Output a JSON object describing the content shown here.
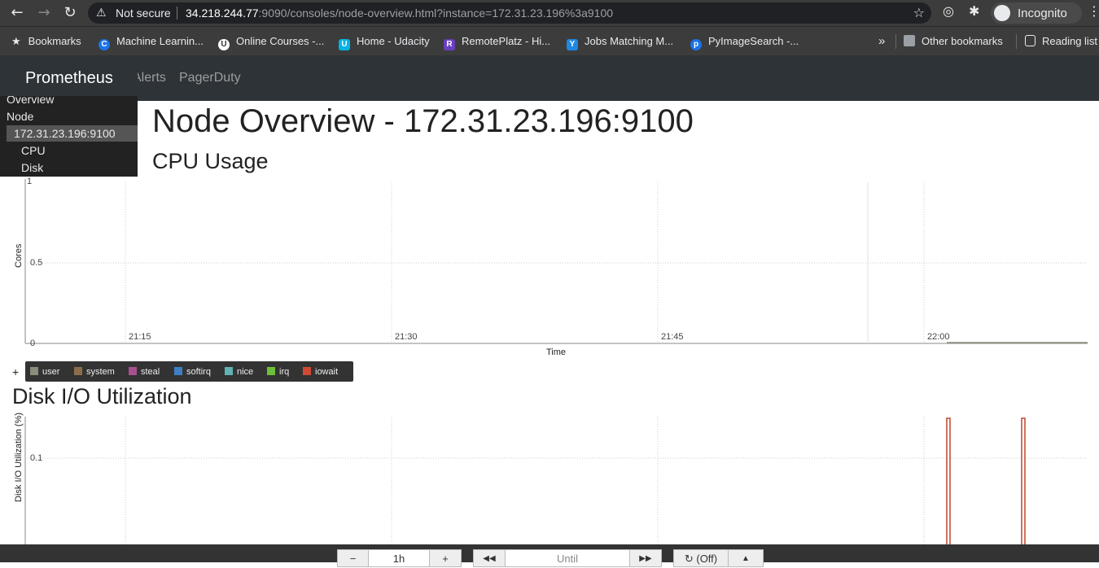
{
  "browser": {
    "security_label": "Not secure",
    "url_host": "34.218.244.77",
    "url_rest": ":9090/consoles/node-overview.html?instance=172.31.23.196%3a9100",
    "incognito_label": "Incognito",
    "bookmarks": [
      {
        "label": "Bookmarks",
        "icon": "star-icon"
      },
      {
        "label": "Machine Learnin...",
        "icon": "c-logo-icon",
        "color": "#1a73e8"
      },
      {
        "label": "Online Courses -...",
        "icon": "udemy-icon",
        "color": "#ffffff"
      },
      {
        "label": "Home - Udacity",
        "icon": "udacity-icon",
        "color": "#02b3e4"
      },
      {
        "label": "RemotePlatz - Hi...",
        "icon": "remoteplatz-icon",
        "color": "#6a3fbf"
      },
      {
        "label": "Jobs Matching M...",
        "icon": "jobs-icon",
        "color": "#1e88e5"
      },
      {
        "label": "PyImageSearch -...",
        "icon": "pyimagesearch-icon",
        "color": "#1a73e8"
      }
    ],
    "overflow_label": "»",
    "other_bookmarks": "Other bookmarks",
    "reading_list": "Reading list"
  },
  "nav": {
    "brand": "Prometheus",
    "links": [
      "Alerts",
      "PagerDuty"
    ]
  },
  "sidebar": {
    "items": [
      "Overview",
      "Node",
      "172.31.23.196:9100",
      "CPU",
      "Disk"
    ],
    "active_index": 2
  },
  "page": {
    "title": "Node Overview - 172.31.23.196:9100",
    "cpu_heading": "CPU Usage",
    "disk_heading": "Disk I/O Utilization"
  },
  "cpu_chart": {
    "ylabel": "Cores",
    "xlabel": "Time",
    "y_ticks": [
      "1",
      "0.5",
      "0"
    ],
    "x_ticks": [
      "21:15",
      "21:30",
      "21:45",
      "22:00"
    ]
  },
  "legend": {
    "plus": "+",
    "items": [
      {
        "name": "user",
        "color": "#8c8c7a"
      },
      {
        "name": "system",
        "color": "#8c6d4a"
      },
      {
        "name": "steal",
        "color": "#a8508f"
      },
      {
        "name": "softirq",
        "color": "#3f7fc4"
      },
      {
        "name": "nice",
        "color": "#5fb3b3"
      },
      {
        "name": "irq",
        "color": "#6dbf3a"
      },
      {
        "name": "iowait",
        "color": "#d04a35"
      }
    ]
  },
  "disk_chart": {
    "ylabel": "Disk I/O Utilization (%)",
    "y_ticks": [
      "0.1"
    ],
    "line_color": "#c0452f"
  },
  "toolbar": {
    "minus": "−",
    "range": "1h",
    "plus": "+",
    "back": "◀◀",
    "until": "Until",
    "forward": "▶▶",
    "refresh": "↻ (Off)",
    "toggle": "▲"
  }
}
